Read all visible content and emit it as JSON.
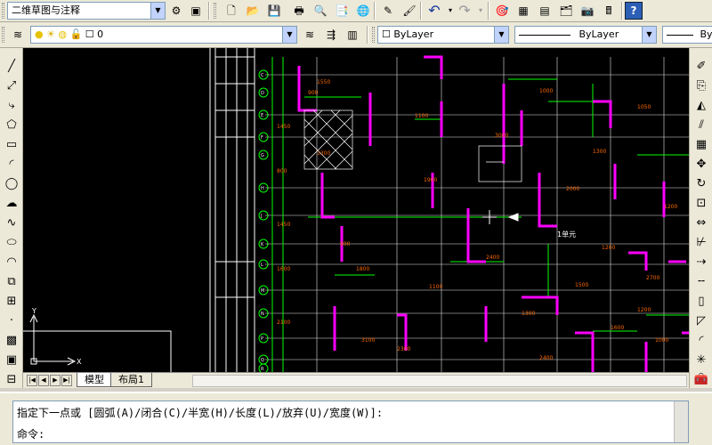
{
  "toolbar": {
    "workspace": "二维草图与注释",
    "layer": "0",
    "color": "ByLayer",
    "linetype": "ByLayer",
    "lineweight": "ByLayer"
  },
  "tabs": [
    "模型",
    "布局1"
  ],
  "command": {
    "prompt": "指定下一点或 [圆弧(A)/闭合(C)/半宽(H)/长度(L)/放弃(U)/宽度(W)]:",
    "input_label": "命令:"
  },
  "canvas": {
    "ucs_x": "X",
    "ucs_y": "Y",
    "label_unit": "1单元"
  },
  "dims": [
    "900",
    "1100",
    "1000",
    "1050",
    "1300",
    "1200",
    "1800",
    "2400",
    "1100",
    "900",
    "1200",
    "1600",
    "1450",
    "800",
    "1450",
    "1600",
    "2100",
    "1550",
    "1300",
    "1900",
    "3000",
    "2000",
    "1200",
    "3100",
    "2400",
    "1500",
    "2700",
    "2300",
    "1000",
    "1300"
  ],
  "grid_labels": [
    "C",
    "D",
    "E",
    "F",
    "G",
    "H",
    "J",
    "K",
    "L",
    "M",
    "N",
    "P",
    "Q",
    "R"
  ],
  "colors": {
    "canvas": "#000000",
    "wall": "#ff00ff",
    "dim": "#00ff00",
    "text": "#ff6a00",
    "line": "#ffffff"
  }
}
